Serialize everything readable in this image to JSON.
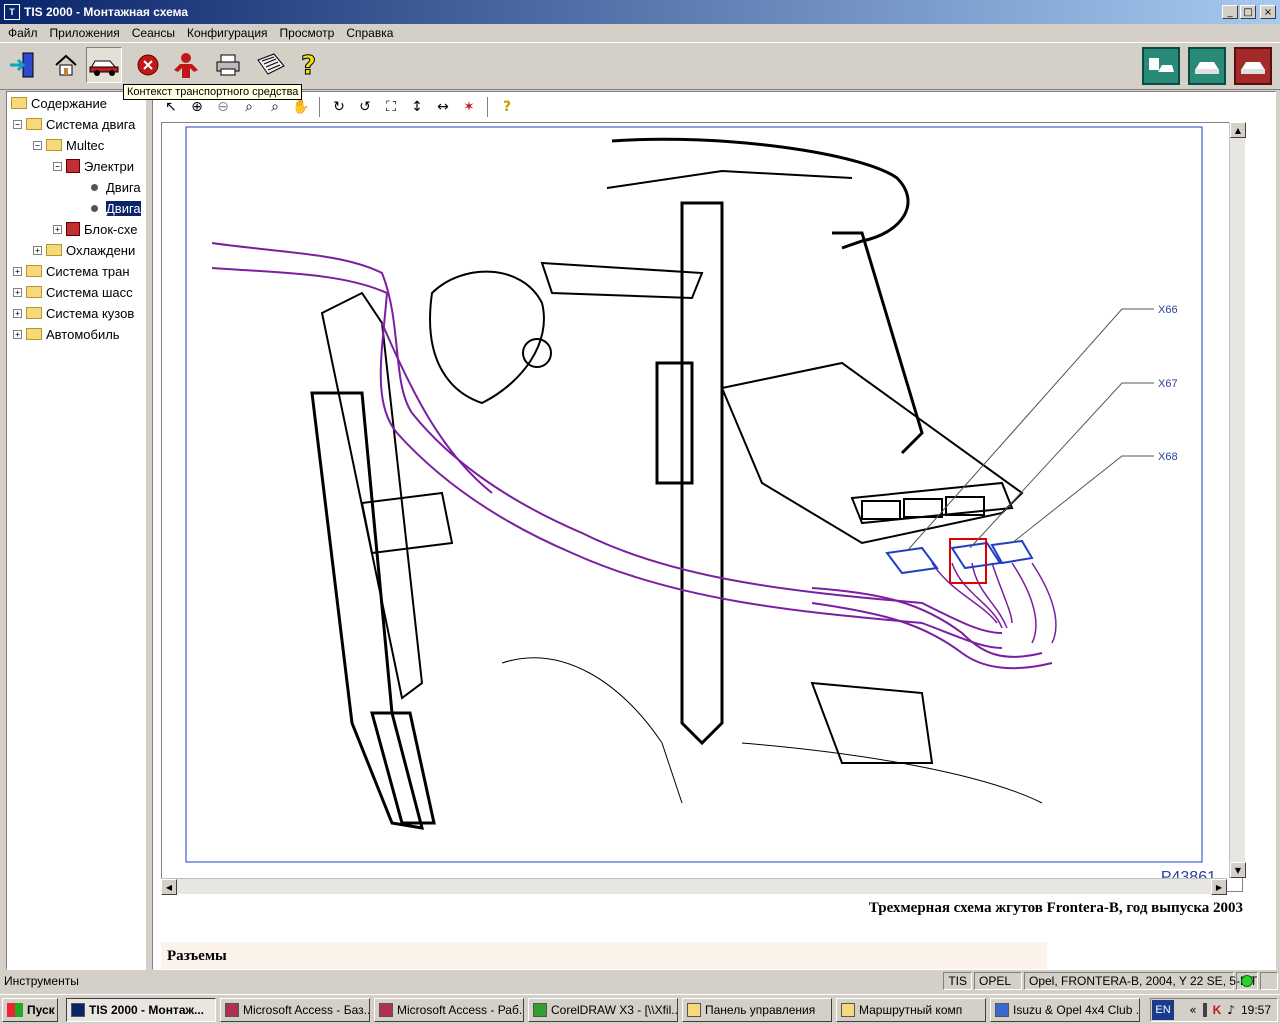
{
  "window": {
    "title": "TIS 2000 - Монтажная схема",
    "app_icon": "T"
  },
  "menu": [
    "Файл",
    "Приложения",
    "Сеансы",
    "Конфигурация",
    "Просмотр",
    "Справка"
  ],
  "tooltip": "Контекст транспортного средства",
  "tree": [
    {
      "label": "Содержание",
      "level": 0
    },
    {
      "label": "Система двига",
      "level": 1
    },
    {
      "label": "Multec",
      "level": 2
    },
    {
      "label": "Электри",
      "level": 3
    },
    {
      "label": "Двига",
      "level": 4
    },
    {
      "label": "Двига",
      "level": 4,
      "selected": true
    },
    {
      "label": "Блок-схе",
      "level": 3
    },
    {
      "label": "Охлаждени",
      "level": 2
    },
    {
      "label": "Система тран",
      "level": 1
    },
    {
      "label": "Система шасс",
      "level": 1
    },
    {
      "label": "Система кузов",
      "level": 1
    },
    {
      "label": "Автомобиль",
      "level": 1
    }
  ],
  "diagram": {
    "connector_labels": [
      "X66",
      "X67",
      "X68"
    ],
    "picture_number": "P43861",
    "colors": {
      "harness": "#7b1fa2",
      "connector": "#1f3fc8",
      "highlight": "#e00000",
      "label": "#2b3f9b"
    }
  },
  "schema_title": "Трехмерная схема жгутов Frontera-B, год выпуска 2003",
  "section_title": "Разъемы",
  "status": {
    "left": "Инструменты",
    "panels": [
      "TIS",
      "OPEL",
      "Opel, FRONTERA-B, 2004, Y 22 SE, 5-MT"
    ]
  },
  "taskbar": {
    "start": "Пуск",
    "tasks": [
      "TIS 2000 - Монтаж...",
      "Microsoft Access - Баз...",
      "Microsoft Access - Раб...",
      "CorelDRAW X3 - [\\\\Xfil...",
      "Панель управления",
      "Маршрутный комп",
      "Isuzu & Opel 4x4 Club ..."
    ],
    "lang": "EN",
    "time": "19:57"
  }
}
